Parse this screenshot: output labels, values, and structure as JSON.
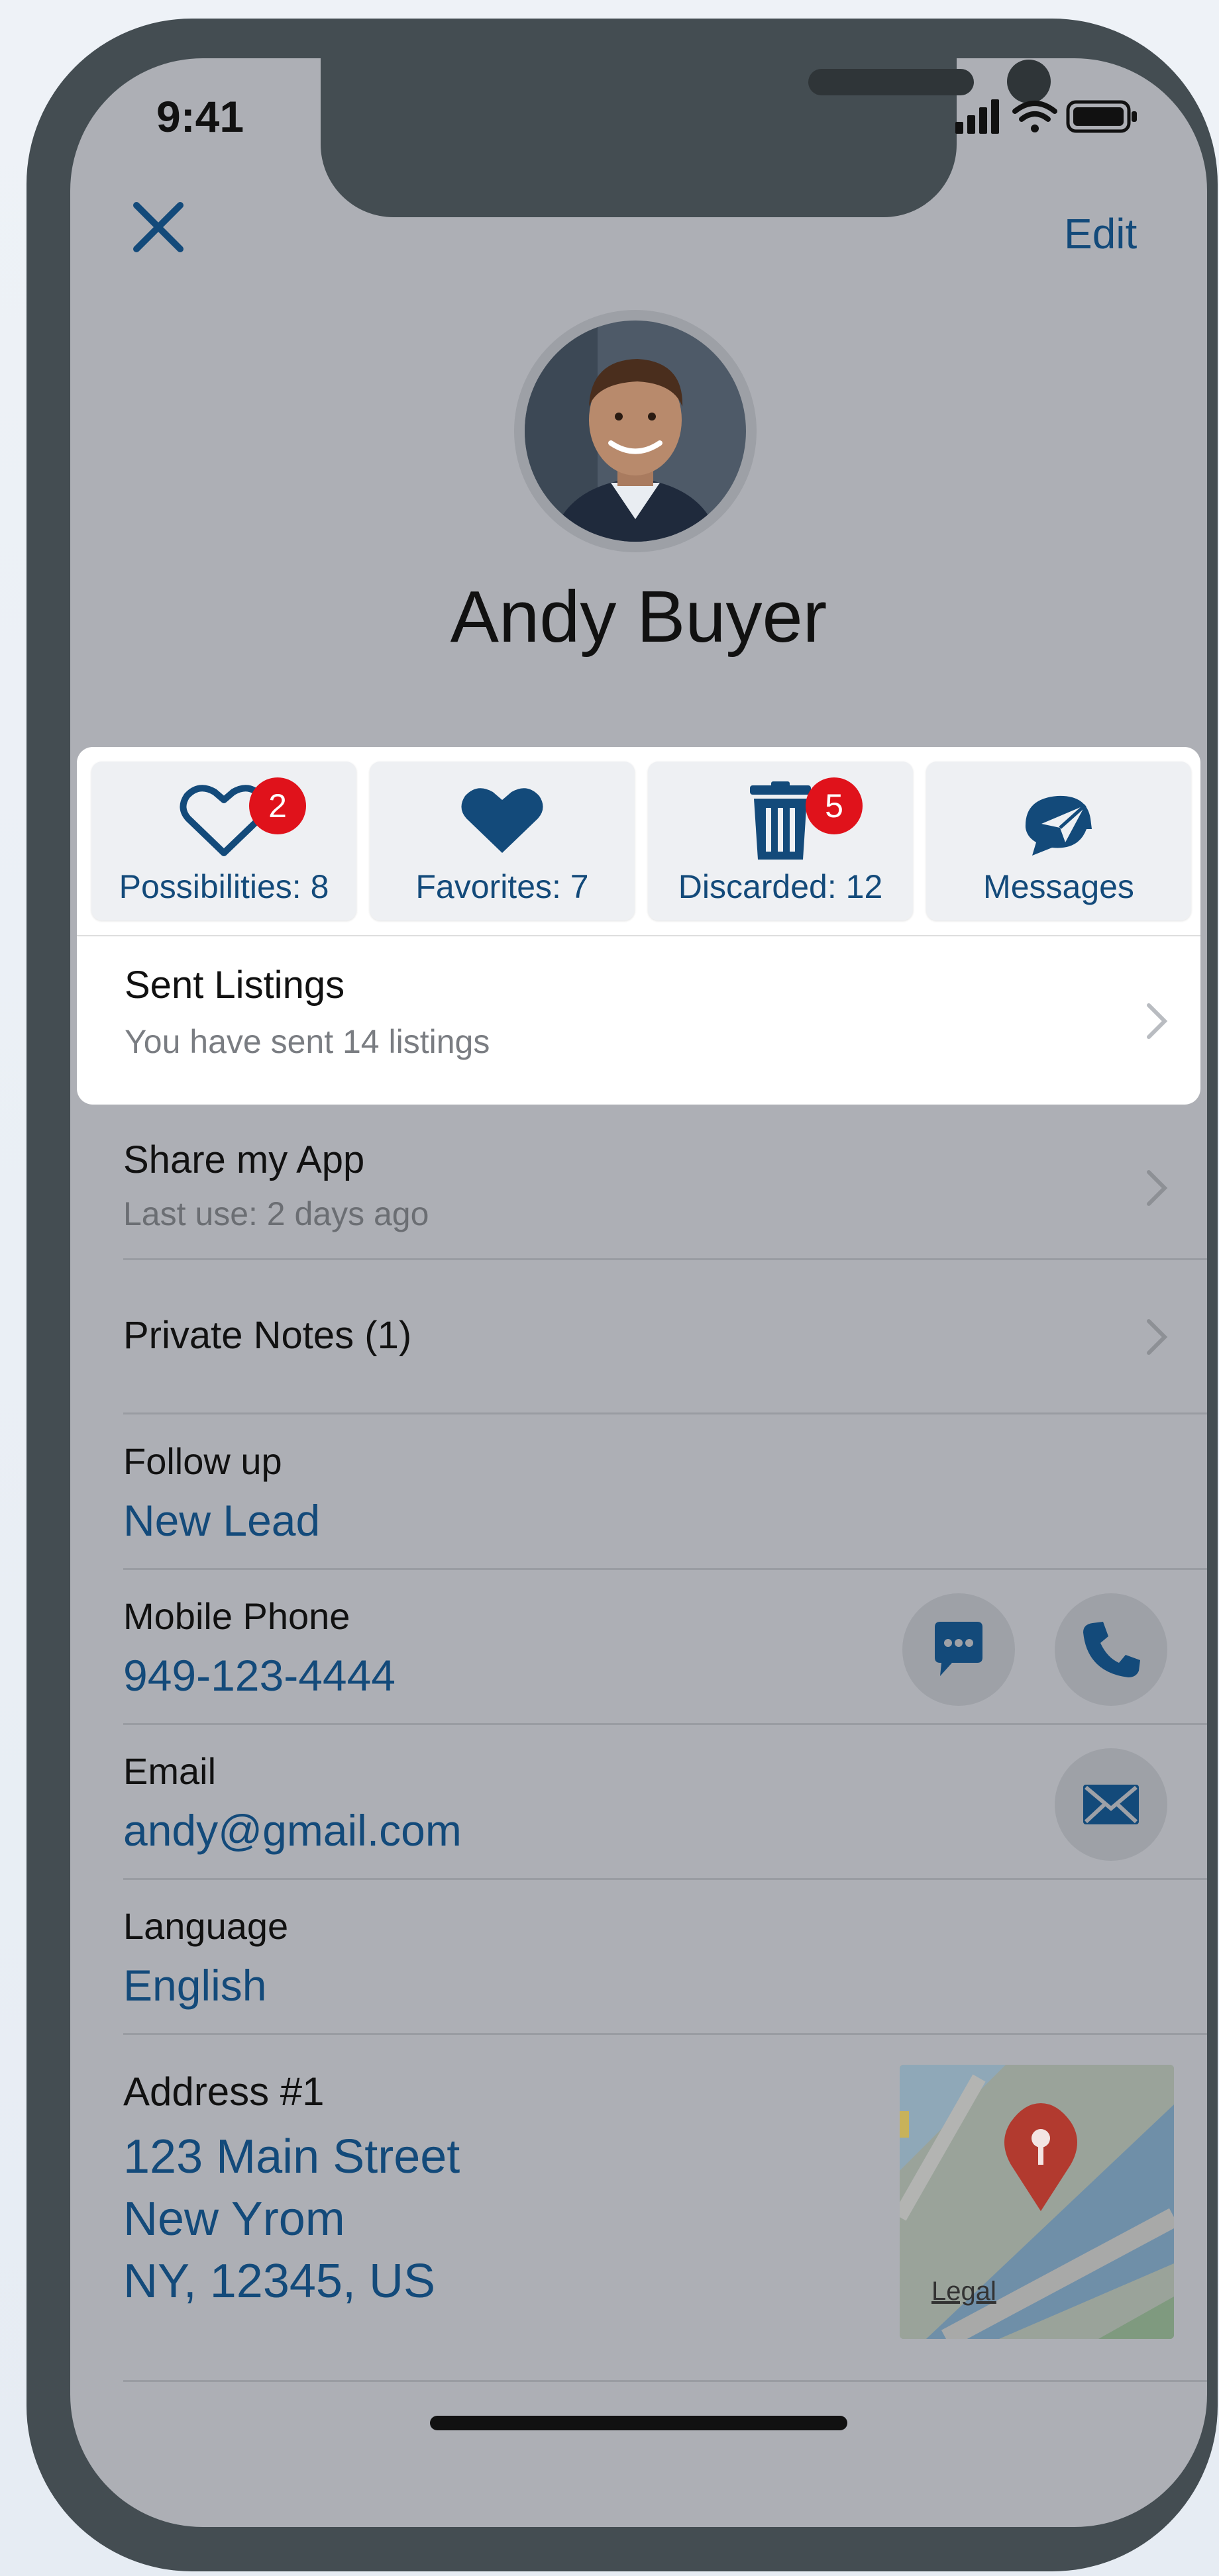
{
  "status_bar": {
    "time": "9:41"
  },
  "nav": {
    "close_icon": "close-icon",
    "edit_label": "Edit"
  },
  "profile": {
    "name": "Andy Buyer"
  },
  "colors": {
    "accent": "#134a7a",
    "badge": "#e0121b",
    "overlay": "#adafb5",
    "card": "#ffffff"
  },
  "stats": [
    {
      "label": "Possibilities: 8",
      "icon": "heart-outline-icon",
      "badge": "2"
    },
    {
      "label": "Favorites: 7",
      "icon": "heart-filled-icon",
      "badge": ""
    },
    {
      "label": "Discarded: 12",
      "icon": "trash-icon",
      "badge": "5"
    },
    {
      "label": "Messages",
      "icon": "paper-plane-chat-icon",
      "badge": ""
    }
  ],
  "sent_listings": {
    "title": "Sent Listings",
    "subtitle": "You have sent 14 listings"
  },
  "share_app": {
    "title": "Share my App",
    "subtitle": "Last use: 2 days ago"
  },
  "private_notes": {
    "title": "Private Notes (1)"
  },
  "follow_up": {
    "label": "Follow up",
    "value": "New Lead"
  },
  "mobile_phone": {
    "label": "Mobile Phone",
    "value": "949-123-4444"
  },
  "email": {
    "label": "Email",
    "value": "andy@gmail.com"
  },
  "language": {
    "label": "Language",
    "value": "English"
  },
  "address": {
    "label": "Address #1",
    "line1": "123 Main Street",
    "line2": "New Yrom",
    "line3": "NY, 12345, US",
    "map_legal": "Legal"
  }
}
